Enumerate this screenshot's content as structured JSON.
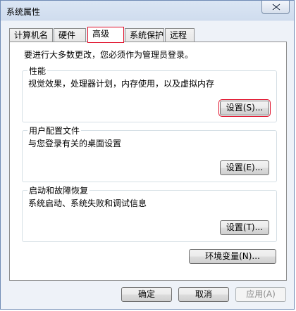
{
  "window": {
    "title": "系统属性"
  },
  "tabs": [
    {
      "label": "计算机名"
    },
    {
      "label": "硬件"
    },
    {
      "label": "高级",
      "active": true
    },
    {
      "label": "系统保护"
    },
    {
      "label": "远程"
    }
  ],
  "advanced": {
    "intro": "要进行大多数更改，您必须作为管理员登录。",
    "performance": {
      "title": "性能",
      "description": "视觉效果，处理器计划，内存使用，以及虚拟内存",
      "button": "设置(S)..."
    },
    "user_profiles": {
      "title": "用户配置文件",
      "description": "与您登录有关的桌面设置",
      "button": "设置(E)..."
    },
    "startup_recovery": {
      "title": "启动和故障恢复",
      "description": "系统启动、系统失败和调试信息",
      "button": "设置(T)..."
    },
    "env_button": "环境变量(N)..."
  },
  "footer": {
    "ok": "确定",
    "cancel": "取消",
    "apply": "应用(A)"
  },
  "colors": {
    "highlight_outline": "#e0102a",
    "window_border": "#6f8bb5"
  }
}
